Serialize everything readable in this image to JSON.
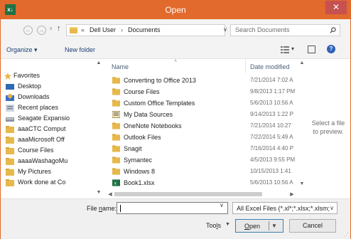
{
  "window": {
    "title": "Open",
    "app_icon_text": "x↓",
    "close_symbol": "✕",
    "accent_color": "#e26a2c"
  },
  "navigation": {
    "back_symbol": "←",
    "forward_symbol": "→",
    "recent_symbol": "∨",
    "up_symbol": "↑",
    "breadcrumb": {
      "overflow": "«",
      "items": [
        "Dell User",
        "Documents"
      ],
      "separator": "›"
    },
    "dropdown_symbol": "∨",
    "refresh_symbol": "↻",
    "search_placeholder": "Search Documents"
  },
  "toolbar": {
    "organize": "Organize ▾",
    "new_folder": "New folder",
    "view_drop": "▾"
  },
  "nav_pane": {
    "items": [
      {
        "label": "Favorites",
        "icon": "star-icon"
      },
      {
        "label": "Desktop",
        "icon": "desktop-icon"
      },
      {
        "label": "Downloads",
        "icon": "downloads-icon"
      },
      {
        "label": "Recent places",
        "icon": "recent-places-icon"
      },
      {
        "label": "Seagate Expansio",
        "icon": "drive-icon"
      },
      {
        "label": "aaaCTC Comput",
        "icon": "folder-icon"
      },
      {
        "label": "aaaMicrosoft Off",
        "icon": "folder-icon"
      },
      {
        "label": "Course Files",
        "icon": "folder-icon"
      },
      {
        "label": "aaaaWashagoMu",
        "icon": "folder-icon"
      },
      {
        "label": "My Pictures",
        "icon": "folder-icon"
      },
      {
        "label": "Work done at Co",
        "icon": "folder-icon"
      }
    ],
    "scroll_up": "▲",
    "scroll_down": "▼"
  },
  "file_list": {
    "columns": {
      "name": "Name",
      "date": "Date modified"
    },
    "sort_indicator": "˄",
    "rows": [
      {
        "name": "Converting to Office 2013",
        "date": "7/21/2014 7:02 A",
        "icon": "folder-icon"
      },
      {
        "name": "Course Files",
        "date": "9/8/2013 1:17 PM",
        "icon": "folder-icon"
      },
      {
        "name": "Custom Office Templates",
        "date": "5/6/2013 10:56 A",
        "icon": "folder-icon"
      },
      {
        "name": "My Data Sources",
        "date": "9/14/2013 1:22 P",
        "icon": "data-sources-icon"
      },
      {
        "name": "OneNote Notebooks",
        "date": "7/21/2014 10:27",
        "icon": "folder-icon"
      },
      {
        "name": "Outlook Files",
        "date": "7/22/2014 5:49 A",
        "icon": "folder-icon"
      },
      {
        "name": "Snagit",
        "date": "7/16/2014 4:40 P",
        "icon": "folder-icon"
      },
      {
        "name": "Symantec",
        "date": "4/5/2013 9:55 PM",
        "icon": "folder-icon"
      },
      {
        "name": "Windows 8",
        "date": "10/15/2013 1:41",
        "icon": "folder-icon"
      },
      {
        "name": "Book1.xlsx",
        "date": "5/6/2013 10:56 A",
        "icon": "excel-file-icon"
      }
    ],
    "scroll_up": "▲",
    "scroll_down": "▼",
    "scroll_left": "◀",
    "scroll_right": "▶"
  },
  "preview": {
    "line1": "Select a file",
    "line2": "to preview."
  },
  "footer": {
    "file_name_prefix": "File ",
    "file_name_access": "n",
    "file_name_suffix": "ame:",
    "file_name_value": "",
    "file_type": "All Excel Files (*.xl*;*.xlsx;*.xlsm;",
    "dropdown_symbol": "∨",
    "tools_prefix": "Too",
    "tools_access": "l",
    "tools_suffix": "s",
    "tools_drop": "▼",
    "open_access": "O",
    "open_suffix": "pen",
    "open_drop": "▼",
    "cancel": "Cancel"
  }
}
